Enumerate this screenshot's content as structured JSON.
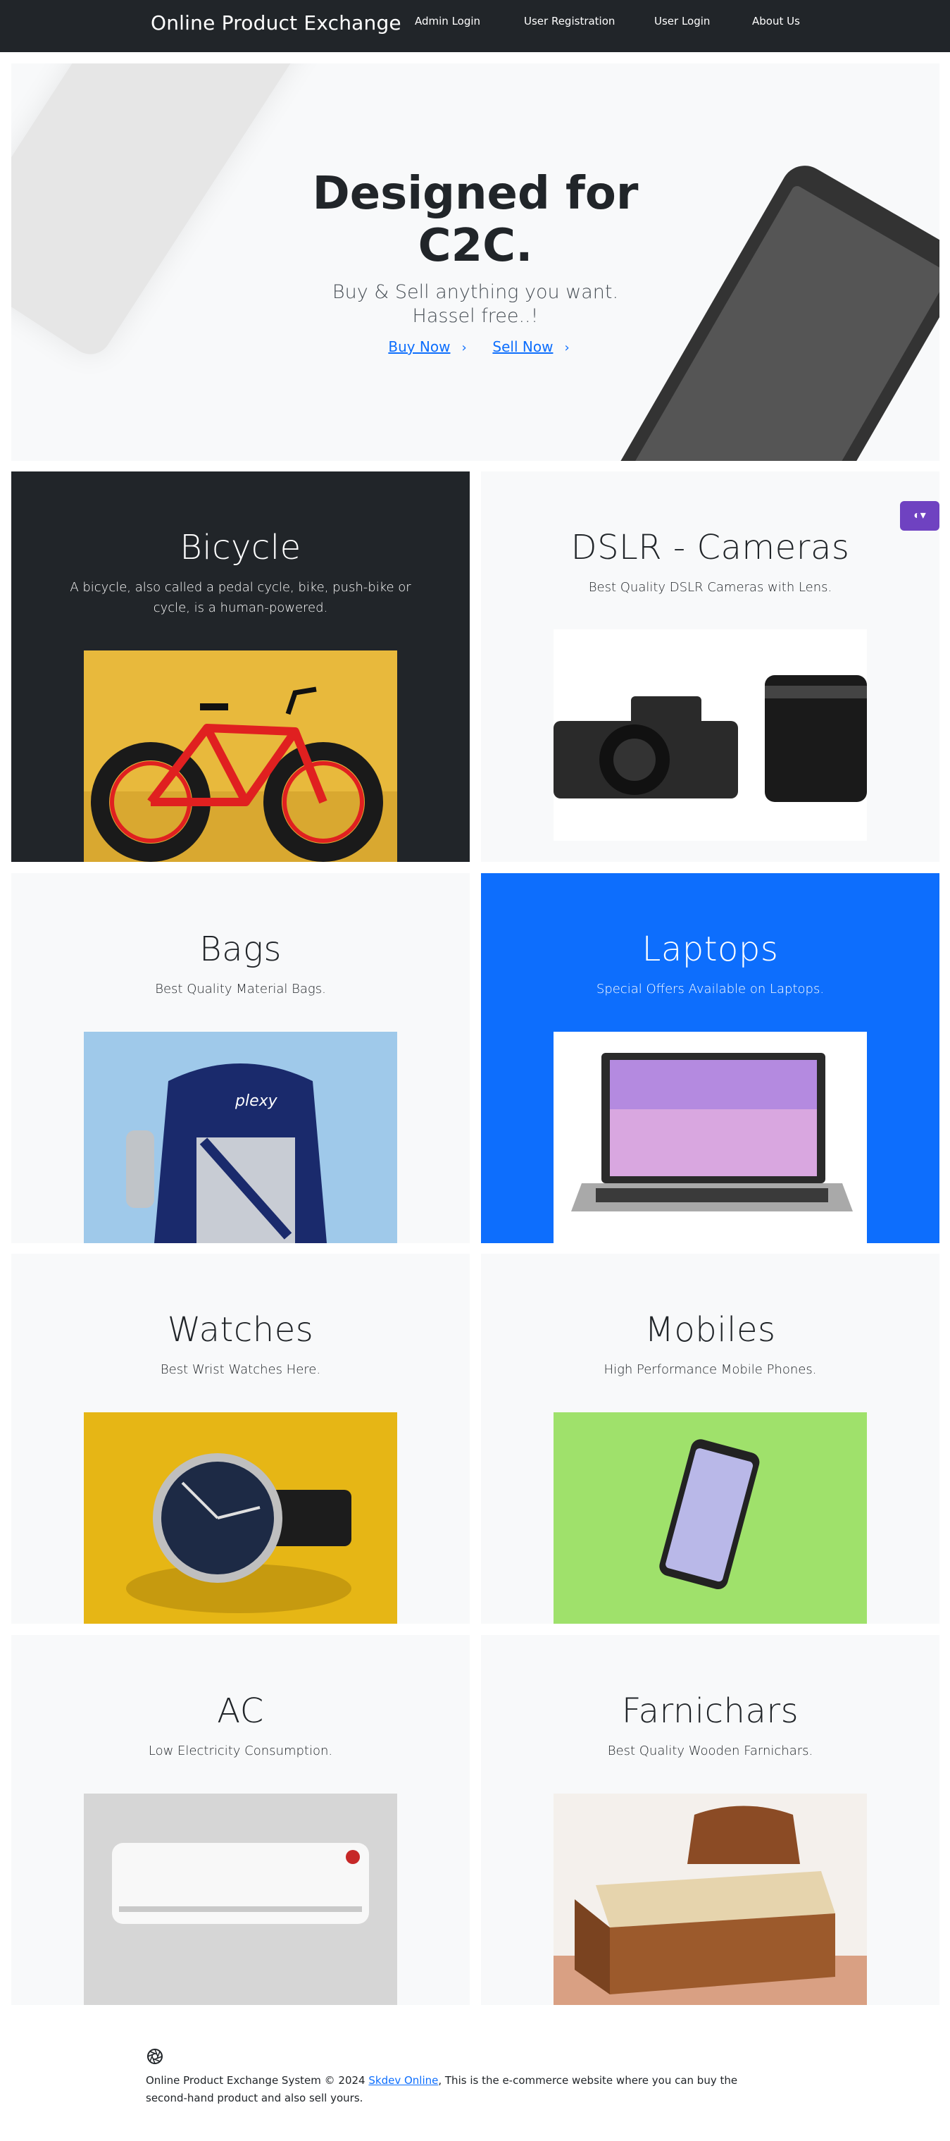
{
  "navbar": {
    "brand": "Online Product Exchange",
    "links": [
      "Admin Login",
      "User Registration",
      "User Login",
      "About Us"
    ]
  },
  "hero": {
    "title_line1": "Designed for",
    "title_line2": "C2C.",
    "subtitle_line1": "Buy & Sell anything you want.",
    "subtitle_line2": "Hassel free..!",
    "buy_label": "Buy Now",
    "sell_label": "Sell Now"
  },
  "products": [
    {
      "title": "Bicycle",
      "description": "A bicycle, also called a pedal cycle, bike, push-bike or cycle, is a human-powered."
    },
    {
      "title": "DSLR - Cameras",
      "description": "Best Quality DSLR Cameras with Lens."
    },
    {
      "title": "Bags",
      "description": "Best Quality Material Bags."
    },
    {
      "title": "Laptops",
      "description": "Special Offers Available on Laptops."
    },
    {
      "title": "Watches",
      "description": "Best Wrist Watches Here."
    },
    {
      "title": "Mobiles",
      "description": "High Performance Mobile Phones."
    },
    {
      "title": "AC",
      "description": "Low Electricity Consumption."
    },
    {
      "title": "Farnichars",
      "description": "Best Quality Wooden Farnichars."
    }
  ],
  "theme_toggle_icon": "contrast-icon",
  "footer": {
    "text_before": "Online Product Exchange System © 2024 ",
    "link": "Skdev Online",
    "text_after": ", This is the e-commerce website where you can buy the second-hand product and also sell yours."
  },
  "colors": {
    "navbar": "#212529",
    "accent_blue": "#0d6efd",
    "light_bg": "#f8f9fa",
    "theme_button": "#6f42c1"
  }
}
